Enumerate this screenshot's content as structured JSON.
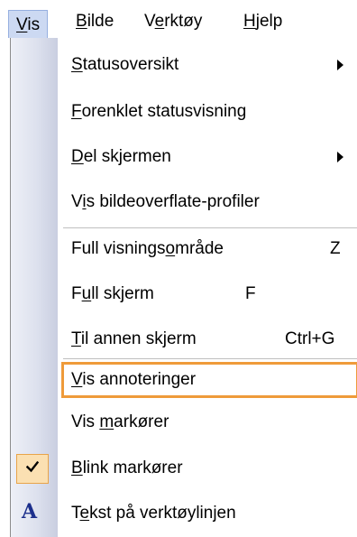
{
  "menubar": {
    "items": [
      {
        "pre": "",
        "key": "V",
        "post": "is"
      },
      {
        "pre": "",
        "key": "B",
        "post": "ilde"
      },
      {
        "pre": "V",
        "key": "e",
        "post": "rktøy"
      },
      {
        "pre": "",
        "key": "H",
        "post": "jelp"
      }
    ]
  },
  "menu": {
    "items": [
      {
        "pre": "",
        "key": "S",
        "post": "tatusoversikt",
        "shortcut": "",
        "submenu": true
      },
      {
        "pre": "",
        "key": "F",
        "post": "orenklet statusvisning",
        "shortcut": ""
      },
      {
        "pre": "",
        "key": "D",
        "post": "el skjermen",
        "shortcut": "",
        "submenu": true
      },
      {
        "pre": "V",
        "key": "i",
        "post": "s bildeoverflate-profiler",
        "shortcut": ""
      },
      {
        "pre": "Full visnings",
        "key": "o",
        "post": "mråde",
        "shortcut": "Z"
      },
      {
        "pre": "F",
        "key": "u",
        "post": "ll skjerm",
        "shortcut": "F"
      },
      {
        "pre": "",
        "key": "T",
        "post": "il annen skjerm",
        "shortcut": "Ctrl+G"
      },
      {
        "pre": "",
        "key": "V",
        "post": "is annoteringer",
        "shortcut": "",
        "focused": true
      },
      {
        "pre": "Vis ",
        "key": "m",
        "post": "arkører",
        "shortcut": ""
      },
      {
        "pre": "",
        "key": "B",
        "post": "link markører",
        "shortcut": "",
        "checked": true
      },
      {
        "pre": "T",
        "key": "e",
        "post": "kst på verktøylinjen",
        "shortcut": "",
        "icon": "font-icon"
      }
    ],
    "check_icon": "checkmark-icon",
    "text_icon_glyph": "A"
  },
  "colors": {
    "focus_border": "#ef9b3a",
    "check_background": "#fbe0b2",
    "active_menu_background": "#ccd9f2"
  }
}
